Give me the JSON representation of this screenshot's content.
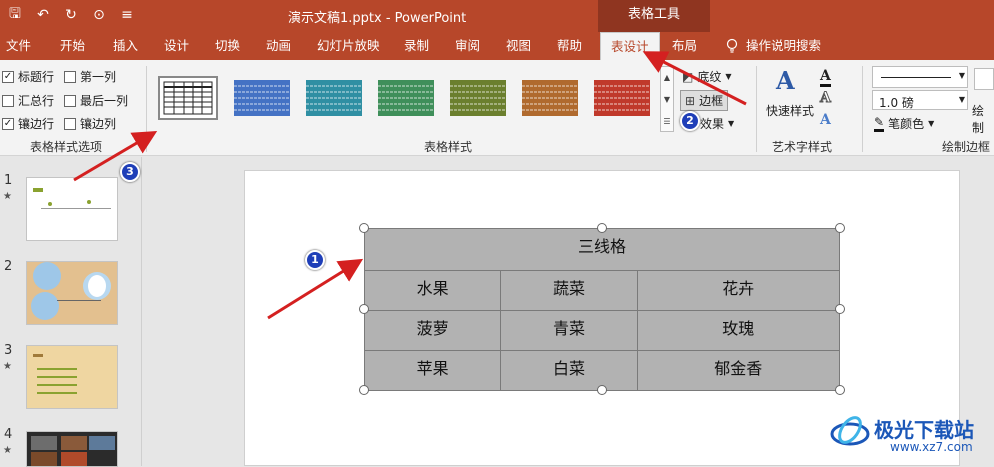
{
  "titlebar": {
    "doc_title": "演示文稿1.pptx  -  PowerPoint",
    "context_tab": "表格工具",
    "qat": [
      {
        "icon": "save-icon",
        "glyph": "🖫"
      },
      {
        "icon": "undo-icon",
        "glyph": "↶"
      },
      {
        "icon": "redo-icon",
        "glyph": "↻"
      },
      {
        "icon": "present-icon",
        "glyph": "⊙"
      },
      {
        "icon": "customize-icon",
        "glyph": "≡"
      }
    ]
  },
  "tabs": [
    {
      "label": "文件"
    },
    {
      "label": "开始"
    },
    {
      "label": "插入"
    },
    {
      "label": "设计"
    },
    {
      "label": "切换"
    },
    {
      "label": "动画"
    },
    {
      "label": "幻灯片放映"
    },
    {
      "label": "录制"
    },
    {
      "label": "审阅"
    },
    {
      "label": "视图"
    },
    {
      "label": "帮助"
    },
    {
      "label": "表设计"
    },
    {
      "label": "布局"
    }
  ],
  "tell_me": "操作说明搜索",
  "ribbon": {
    "options": [
      {
        "label": "标题行",
        "checked": true
      },
      {
        "label": "第一列",
        "checked": false
      },
      {
        "label": "汇总行",
        "checked": false
      },
      {
        "label": "最后一列",
        "checked": false
      },
      {
        "label": "镶边行",
        "checked": true
      },
      {
        "label": "镶边列",
        "checked": false
      }
    ],
    "options_group": "表格样式选项",
    "styles_group": "表格样式",
    "style_colors": [
      "#ffffff",
      "#4472c4",
      "#2f8fa3",
      "#3f8f5a",
      "#6b7f2e",
      "#b06a2e",
      "#c0392b"
    ],
    "shading": "底纹",
    "border": "边框",
    "effects": "效果",
    "quick_styles": "快速样式",
    "wordart_group": "艺术字样式",
    "pen_weight": "1.0 磅",
    "pen_color": "笔颜色",
    "draw_border_group": "绘制边框",
    "draw_table": "绘制"
  },
  "slides": [
    {
      "num": "1",
      "star": "★"
    },
    {
      "num": "2",
      "star": ""
    },
    {
      "num": "3",
      "star": "★"
    },
    {
      "num": "4",
      "star": "★"
    }
  ],
  "table": {
    "title": "三线格",
    "rows": [
      [
        "水果",
        "蔬菜",
        "花卉"
      ],
      [
        "菠萝",
        "青菜",
        "玫瑰"
      ],
      [
        "苹果",
        "白菜",
        "郁金香"
      ]
    ]
  },
  "badges": [
    "1",
    "2",
    "3"
  ],
  "watermark": {
    "name": "极光下载站",
    "url": "www.xz7.com"
  }
}
